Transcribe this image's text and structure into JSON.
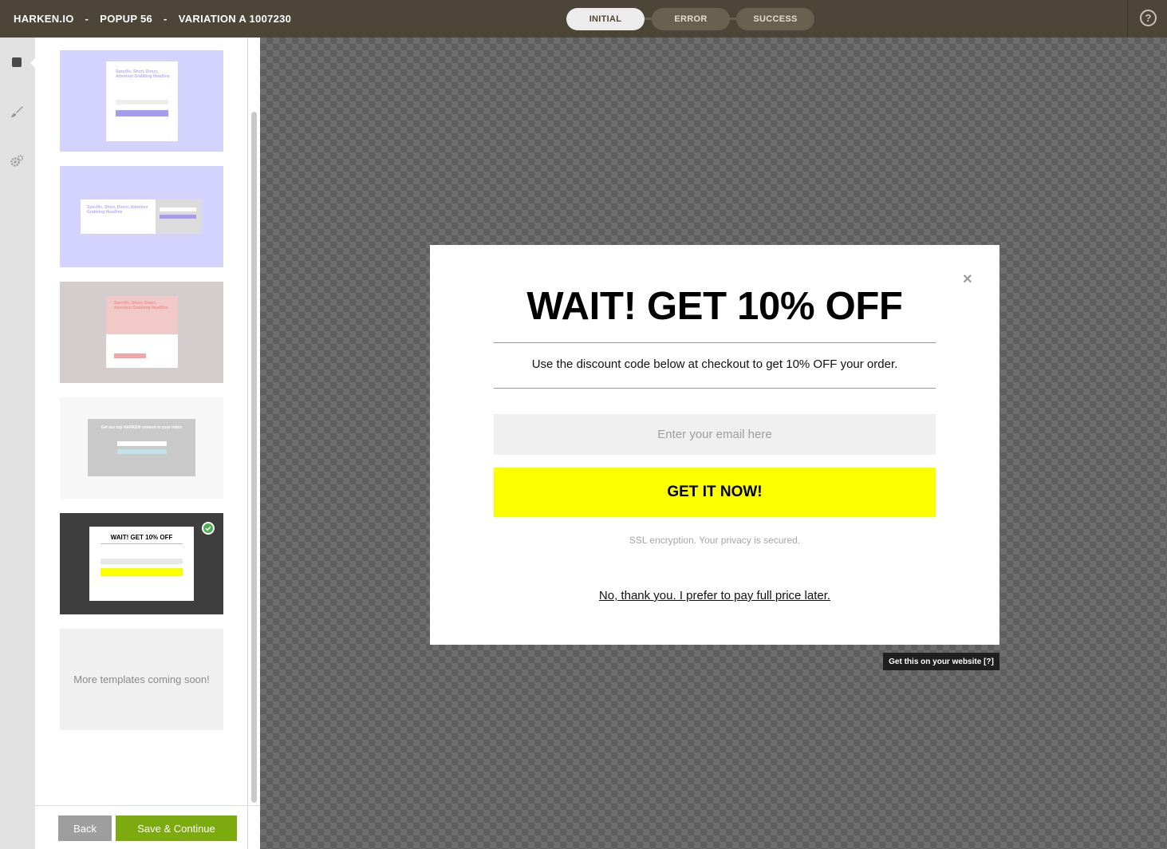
{
  "header": {
    "brand": "HARKEN.IO",
    "popup": "POPUP 56",
    "variation": "VARIATION A 1007230",
    "separator": "-",
    "steps": [
      {
        "label": "INITIAL",
        "active": true
      },
      {
        "label": "ERROR",
        "active": false
      },
      {
        "label": "SUCCESS",
        "active": false
      }
    ],
    "help_symbol": "?"
  },
  "rail": {
    "items": [
      {
        "icon": "layout-square-icon"
      },
      {
        "icon": "paintbrush-icon"
      },
      {
        "icon": "gears-icon"
      }
    ]
  },
  "templates": {
    "thumbnails": [
      {
        "name": "template-lavender-card",
        "headline": "Specific, Short, Direct, Attention Grabbing Headline",
        "bg": "#d4d2ff",
        "accent": "#a59cf0"
      },
      {
        "name": "template-lavender-wide",
        "headline": "Specific, Short, Direct, Attention Grabbing Headline",
        "bg": "#d4d2ff",
        "accent": "#a59cf0"
      },
      {
        "name": "template-pink",
        "headline": "Specific, Short, Direct, Attention Grabbing Headline",
        "bg": "#d3cdcd",
        "accent": "#f1c9c9"
      },
      {
        "name": "template-grey-banner",
        "headline": "Get our top HARKEN content in your inbox",
        "bg": "#f7f7f7",
        "accent": "#c9c9c9"
      },
      {
        "name": "template-discount",
        "headline": "WAIT! GET 10% OFF",
        "bg": "#3e3e3e",
        "accent": "#fbff00",
        "selected": true
      }
    ],
    "more_label": "More templates coming soon!"
  },
  "footer": {
    "back_label": "Back",
    "save_label": "Save & Continue"
  },
  "popup": {
    "title": "WAIT! GET 10% OFF",
    "subtitle": "Use the discount code below at checkout to get 10% OFF your order.",
    "email_placeholder": "Enter your email here",
    "cta_label": "GET IT NOW!",
    "ssl_note": "SSL encryption. Your privacy is secured.",
    "decline_label": "No, thank you. I prefer to pay full price later.",
    "close_symbol": "×",
    "badge_label": "Get this on your website [?]",
    "colors": {
      "cta": "#fbff00",
      "field": "#efefef"
    }
  },
  "theme": {
    "topbar": "#4d4537",
    "save_button": "#7cab10",
    "back_button": "#9e9e9e"
  }
}
